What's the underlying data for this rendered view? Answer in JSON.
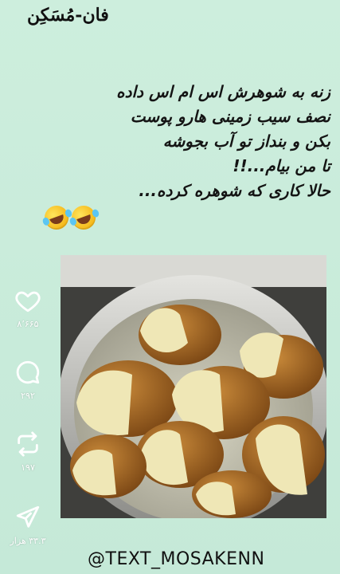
{
  "brand": {
    "logo_text": "فان-مُسَکِن"
  },
  "caption": {
    "lines": [
      "زنه به شوهرش اس ام اس داده",
      "نصف سیب زمینی هارو پوست",
      "بکن و بنداز تو آب بجوشه",
      "تا من بیام...!!",
      "حالا کاری که شوهره کرده..."
    ]
  },
  "emojis": [
    "rolling-on-floor-laughing",
    "rolling-on-floor-laughing"
  ],
  "actions": {
    "like": {
      "icon": "heart-icon",
      "count": "۸٬۶۶۵"
    },
    "comment": {
      "icon": "comment-icon",
      "count": "۲۹۲"
    },
    "repost": {
      "icon": "repost-icon",
      "count": "۱۹۷"
    },
    "share": {
      "icon": "send-icon",
      "count": "۳۳.۳ هزار"
    }
  },
  "footer": {
    "handle": "@TEXT_MOSAKENN"
  }
}
